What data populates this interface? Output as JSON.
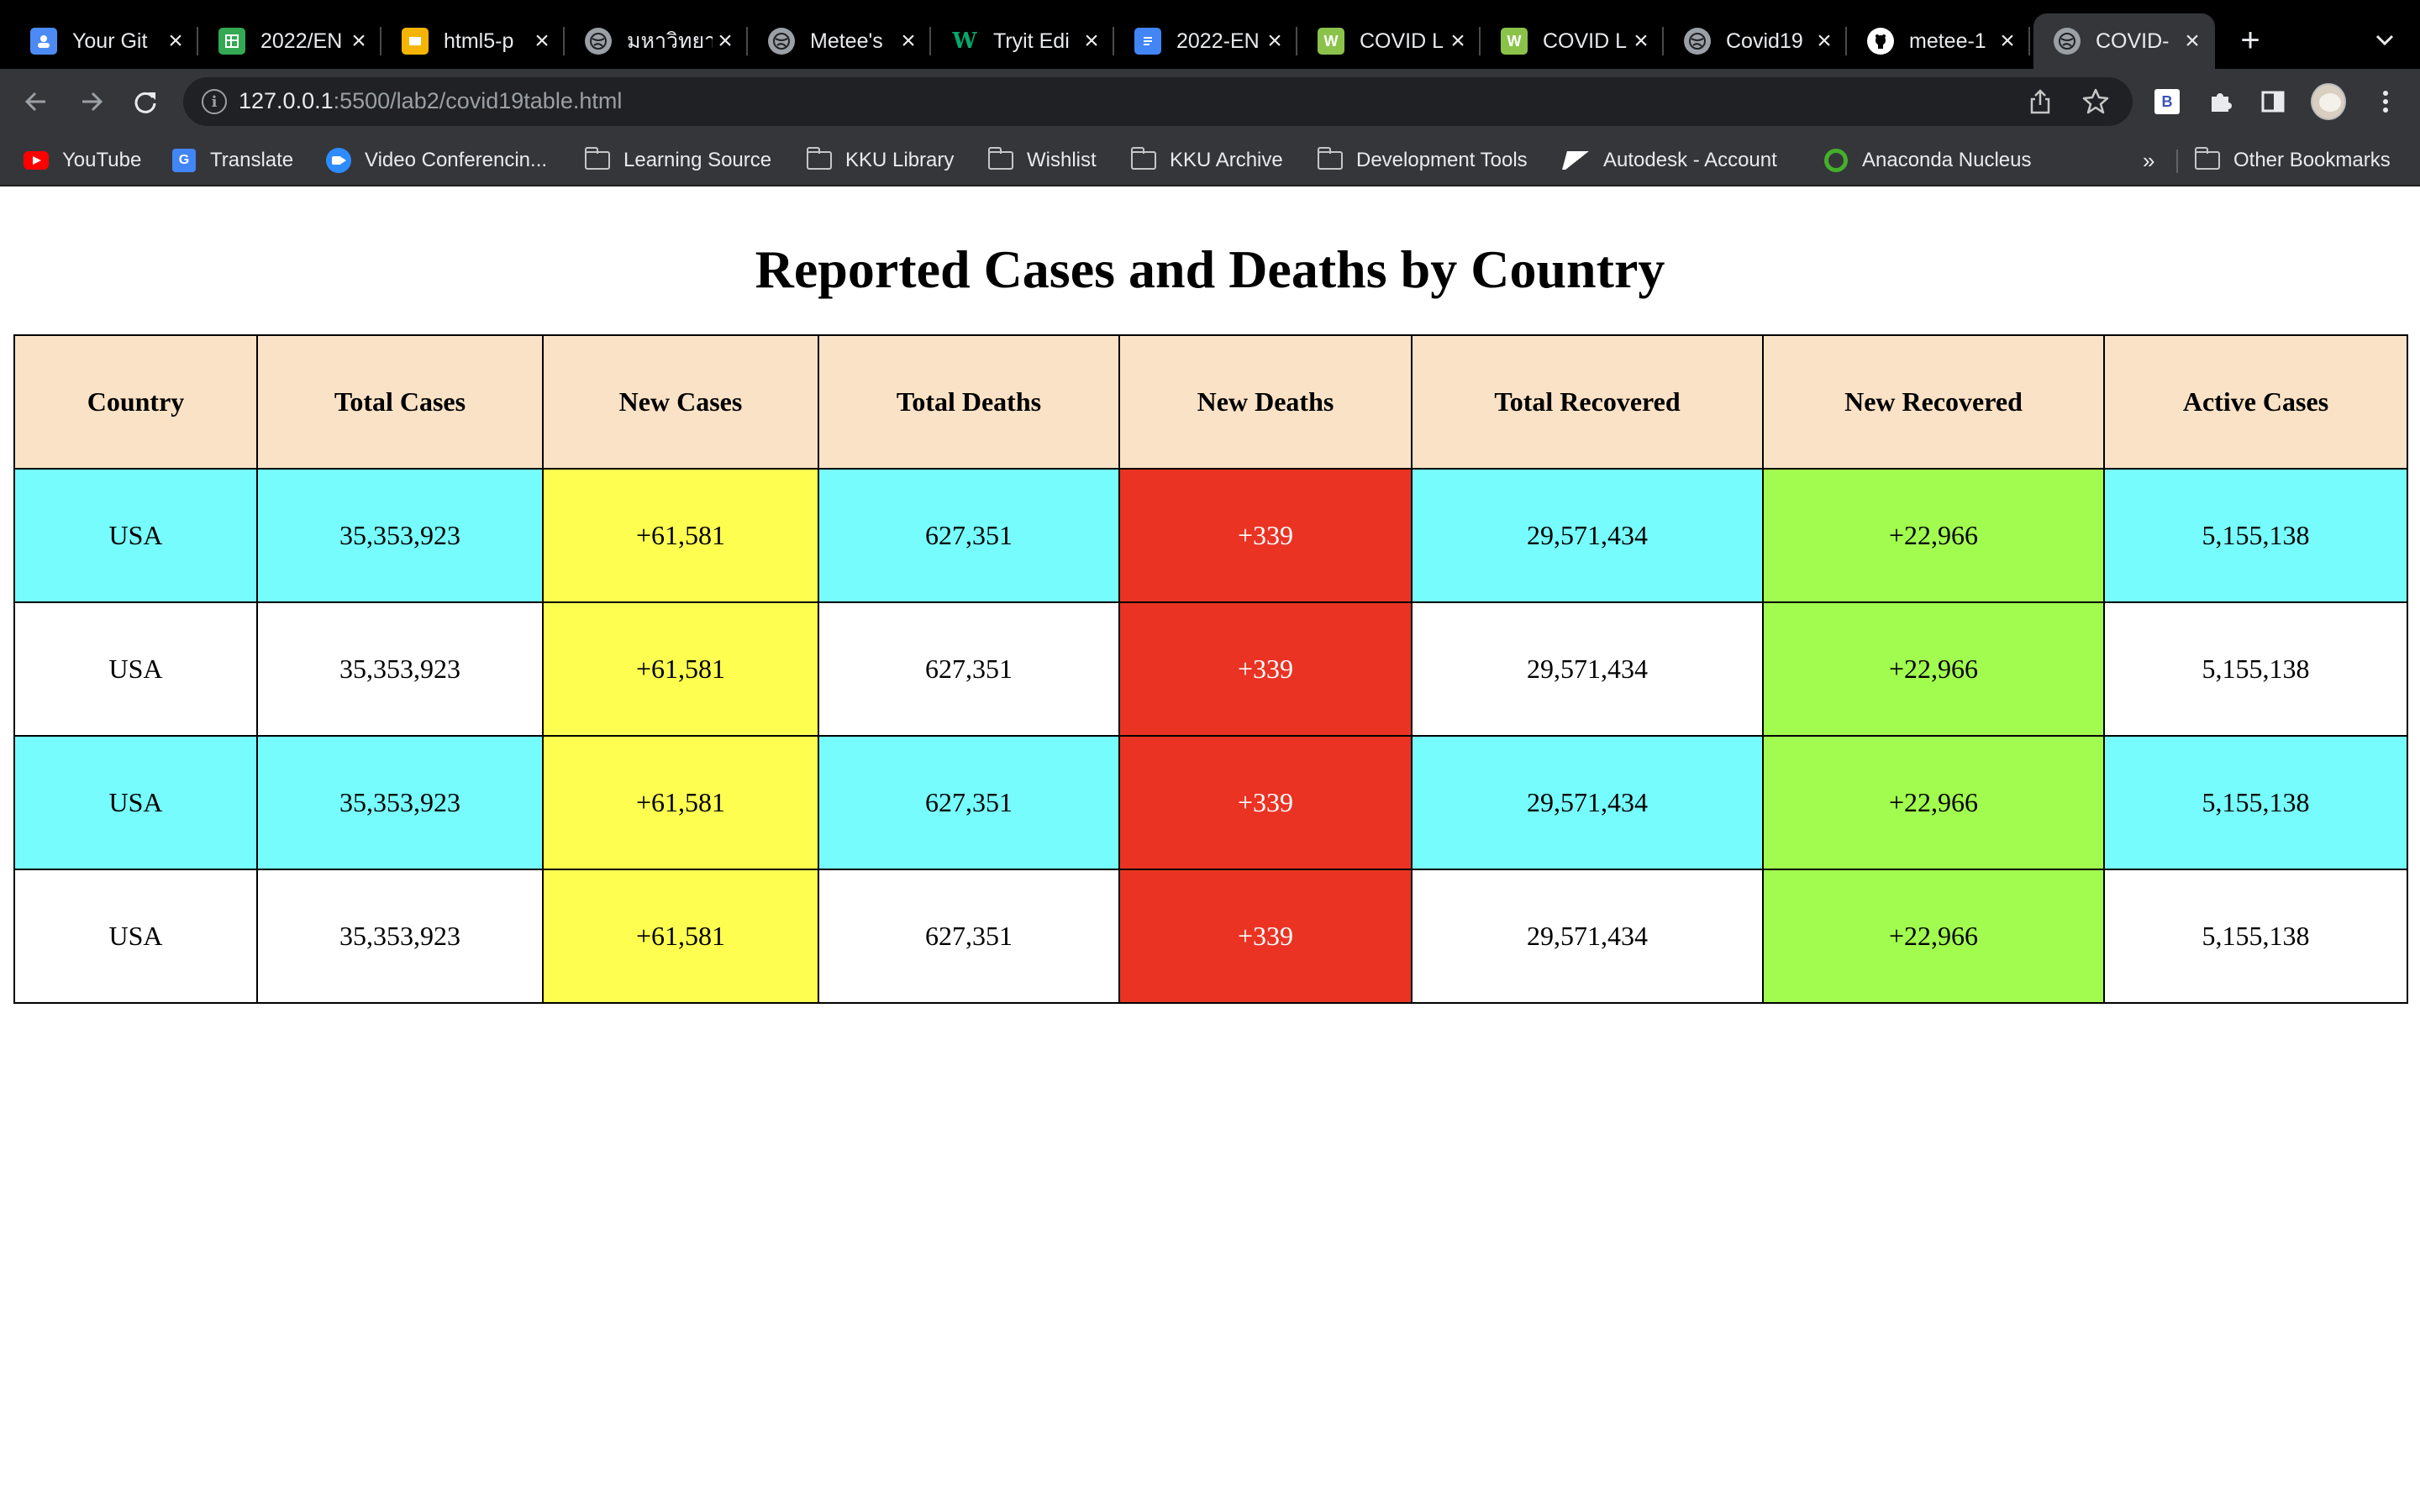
{
  "browser": {
    "tabs": [
      {
        "title": "Your Git",
        "favicon": "person-icon",
        "color": "#4c8bf5"
      },
      {
        "title": "2022/EN",
        "favicon": "sheets-icon",
        "color": "#34a853"
      },
      {
        "title": "html5-p",
        "favicon": "slides-icon",
        "color": "#f4b400"
      },
      {
        "title": "มหาวิทยา",
        "favicon": "globe-icon",
        "color": "#5f6368"
      },
      {
        "title": "Metee's",
        "favicon": "globe-icon",
        "color": "#5f6368"
      },
      {
        "title": "Tryit Edi",
        "favicon": "w3schools-icon",
        "color": "#04aa6d"
      },
      {
        "title": "2022-EN",
        "favicon": "docs-icon",
        "color": "#4285f4"
      },
      {
        "title": "COVID L",
        "favicon": "worldometer-icon",
        "color": "#8bc34a"
      },
      {
        "title": "COVID L",
        "favicon": "worldometer-icon",
        "color": "#8bc34a"
      },
      {
        "title": "Covid19",
        "favicon": "globe-icon",
        "color": "#5f6368"
      },
      {
        "title": "metee-1",
        "favicon": "github-icon",
        "color": "#ffffff"
      },
      {
        "title": "COVID-",
        "favicon": "globe-icon",
        "color": "#5f6368"
      }
    ],
    "url_host": "127.0.0.1",
    "url_rest": ":5500/lab2/covid19table.html",
    "extension_label": "B",
    "bookmarks": [
      {
        "label": "YouTube",
        "icon": "youtube-icon"
      },
      {
        "label": "Translate",
        "icon": "translate-icon"
      },
      {
        "label": "Video Conferencin...",
        "icon": "zoom-icon"
      },
      {
        "label": "Learning Source",
        "icon": "folder-icon"
      },
      {
        "label": "KKU Library",
        "icon": "folder-icon"
      },
      {
        "label": "Wishlist",
        "icon": "folder-icon"
      },
      {
        "label": "KKU Archive",
        "icon": "folder-icon"
      },
      {
        "label": "Development Tools",
        "icon": "folder-icon"
      },
      {
        "label": "Autodesk - Account",
        "icon": "autodesk-icon"
      },
      {
        "label": "Anaconda Nucleus",
        "icon": "anaconda-icon"
      }
    ],
    "bookmarks_overflow": "»",
    "other_bookmarks": "Other Bookmarks"
  },
  "page": {
    "title": "Reported Cases and Deaths by Country",
    "headers": [
      "Country",
      "Total Cases",
      "New Cases",
      "Total Deaths",
      "New Deaths",
      "Total Recovered",
      "New Recovered",
      "Active Cases"
    ],
    "rows": [
      [
        "USA",
        "35,353,923",
        "+61,581",
        "627,351",
        "+339",
        "29,571,434",
        "+22,966",
        "5,155,138"
      ],
      [
        "USA",
        "35,353,923",
        "+61,581",
        "627,351",
        "+339",
        "29,571,434",
        "+22,966",
        "5,155,138"
      ],
      [
        "USA",
        "35,353,923",
        "+61,581",
        "627,351",
        "+339",
        "29,571,434",
        "+22,966",
        "5,155,138"
      ],
      [
        "USA",
        "35,353,923",
        "+61,581",
        "627,351",
        "+339",
        "29,571,434",
        "+22,966",
        "5,155,138"
      ]
    ],
    "colors": {
      "header_bg": "#f9e2c6",
      "row_alt_bg": "#77fcfd",
      "new_cases_bg": "#fefe51",
      "new_deaths_bg": "#ea3323",
      "new_recovered_bg": "#a1fc4f"
    }
  }
}
